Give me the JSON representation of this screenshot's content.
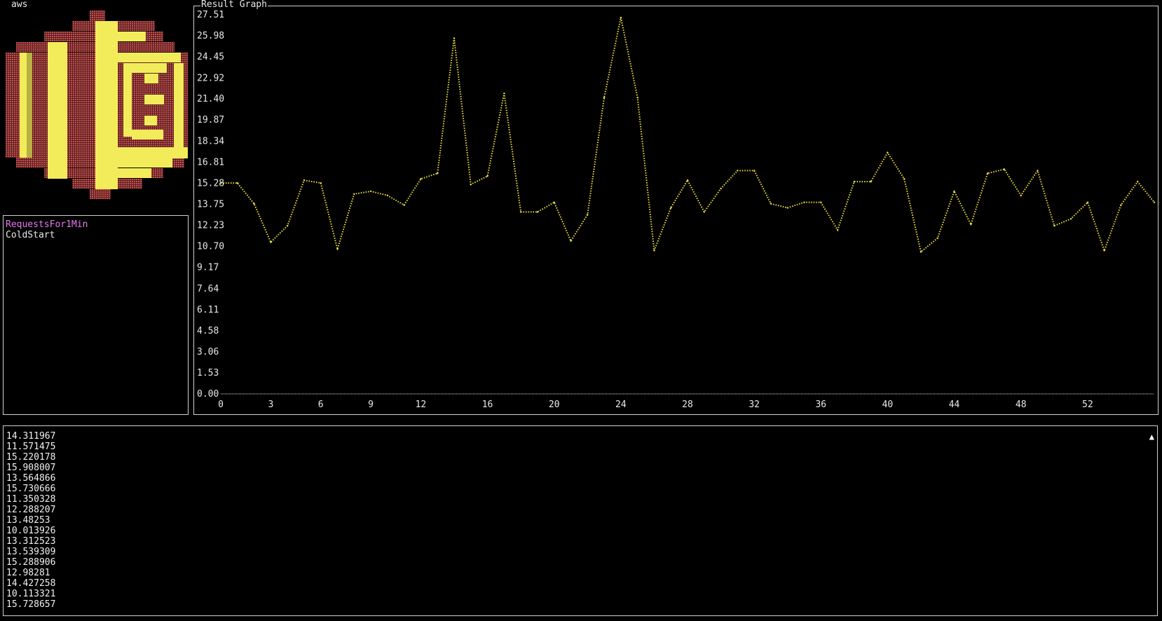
{
  "app": {
    "logo_title": "aws",
    "graph_title": "Result Graph",
    "logo_icon": "aws-lambda-logo-icon",
    "colors": {
      "plot": "#f0e040",
      "selected_metric": "#e879f0",
      "border": "#d0d0d0",
      "logo_yellow": "#f3ec5a",
      "logo_red": "#b84848"
    }
  },
  "metrics": [
    {
      "label": "RequestsFor1Min",
      "selected": true
    },
    {
      "label": "ColdStart",
      "selected": false
    }
  ],
  "log": {
    "lines": [
      "14.311967",
      "11.571475",
      "15.220178",
      "15.908007",
      "13.564866",
      "15.730666",
      "11.350328",
      "12.288207",
      "13.48253",
      "10.013926",
      "13.312523",
      "13.539309",
      "15.288906",
      "12.98281",
      "14.427258",
      "10.113321",
      "15.728657"
    ],
    "scroll_icon": "arrow-up-icon"
  },
  "chart_data": {
    "type": "line",
    "title": "Result Graph",
    "xlabel": "",
    "ylabel": "",
    "xlim": [
      0,
      56
    ],
    "ylim": [
      0,
      27.51
    ],
    "x_ticks": [
      "0",
      "3",
      "6",
      "9",
      "12",
      "16",
      "20",
      "24",
      "28",
      "32",
      "36",
      "40",
      "44",
      "48",
      "52"
    ],
    "y_ticks": [
      "0.00",
      "1.53",
      "3.06",
      "4.58",
      "6.11",
      "7.64",
      "9.17",
      "10.70",
      "12.23",
      "13.75",
      "15.28",
      "16.81",
      "18.34",
      "19.87",
      "21.40",
      "22.92",
      "24.45",
      "25.98",
      "27.51"
    ],
    "grid": false,
    "series": [
      {
        "color": "#f0e040",
        "x": [
          0,
          1,
          2,
          3,
          4,
          5,
          6,
          7,
          8,
          9,
          10,
          11,
          12,
          13,
          14,
          15,
          16,
          17,
          18,
          19,
          20,
          21,
          22,
          23,
          24,
          25,
          26,
          27,
          28,
          29,
          30,
          31,
          32,
          33,
          34,
          35,
          36,
          37,
          38,
          39,
          40,
          41,
          42,
          43,
          44,
          45,
          46,
          47,
          48,
          49,
          50,
          51,
          52,
          53,
          54,
          55,
          56
        ],
        "values": [
          15.3,
          15.3,
          13.8,
          11.0,
          12.2,
          15.5,
          15.3,
          10.5,
          14.5,
          14.7,
          14.4,
          13.7,
          15.6,
          16.0,
          25.8,
          15.2,
          15.8,
          21.8,
          13.2,
          13.2,
          13.9,
          11.1,
          13.0,
          21.5,
          27.3,
          21.5,
          10.4,
          13.5,
          15.5,
          13.2,
          14.9,
          16.2,
          16.2,
          13.8,
          13.5,
          13.9,
          13.9,
          11.9,
          15.4,
          15.4,
          17.5,
          15.6,
          10.3,
          11.3,
          14.7,
          12.3,
          16.0,
          16.3,
          14.4,
          16.2,
          12.2,
          12.7,
          13.9,
          10.4,
          13.7,
          15.4,
          13.9
        ]
      }
    ]
  }
}
